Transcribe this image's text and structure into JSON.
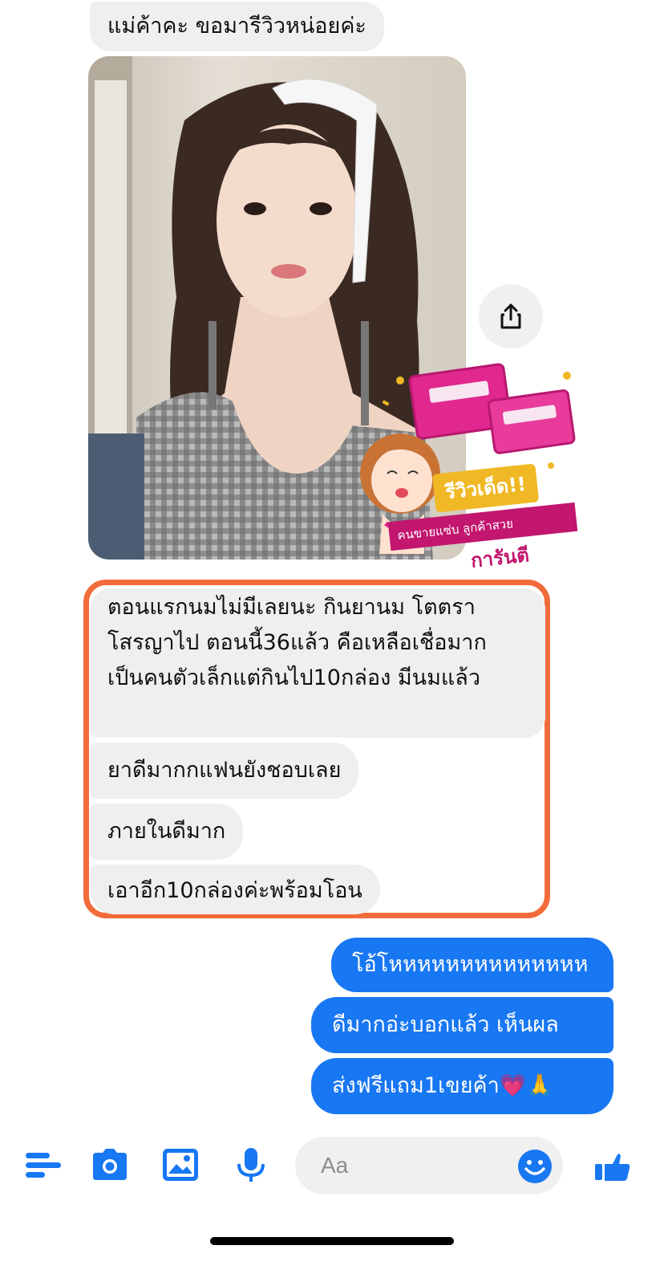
{
  "messages_in": [
    "แม่ค้าคะ ขอมารีวิวหน่อยค่ะ",
    "ตอนแรกนมไม่มีเลยนะ กินยานม โตตราโสรญาไป ตอนนี้36แล้ว คือเหลือเชื่อมาก เป็นคนตัวเล็กแต่กินไป10กล่อง มีนมแล้ว",
    "ยาดีมากกแฟนยังชอบเลย",
    "ภายในดีมาก",
    "เอาอีก10กล่องค่ะพร้อมโอน"
  ],
  "messages_out": [
    "โอ้โหหหหหหหหหหหหหห",
    "ดีมากอ่ะบอกแล้ว เห็นผล",
    "ส่งฟรีแถม1เขยค้า💗🙏"
  ],
  "badge": {
    "title": "รีวิวเด็ด!!",
    "ribbon": "คนขายแซ่บ ลูกค้าสวย",
    "guarantee": "การันตี"
  },
  "composer": {
    "placeholder": "Aa"
  },
  "colors": {
    "accent": "#1877f2",
    "incoming_bubble": "#efefef",
    "highlight_border": "#f26b3a"
  },
  "icons": [
    "menu-icon",
    "camera-icon",
    "image-icon",
    "microphone-icon",
    "emoji-icon",
    "thumbs-up-icon",
    "share-icon"
  ]
}
